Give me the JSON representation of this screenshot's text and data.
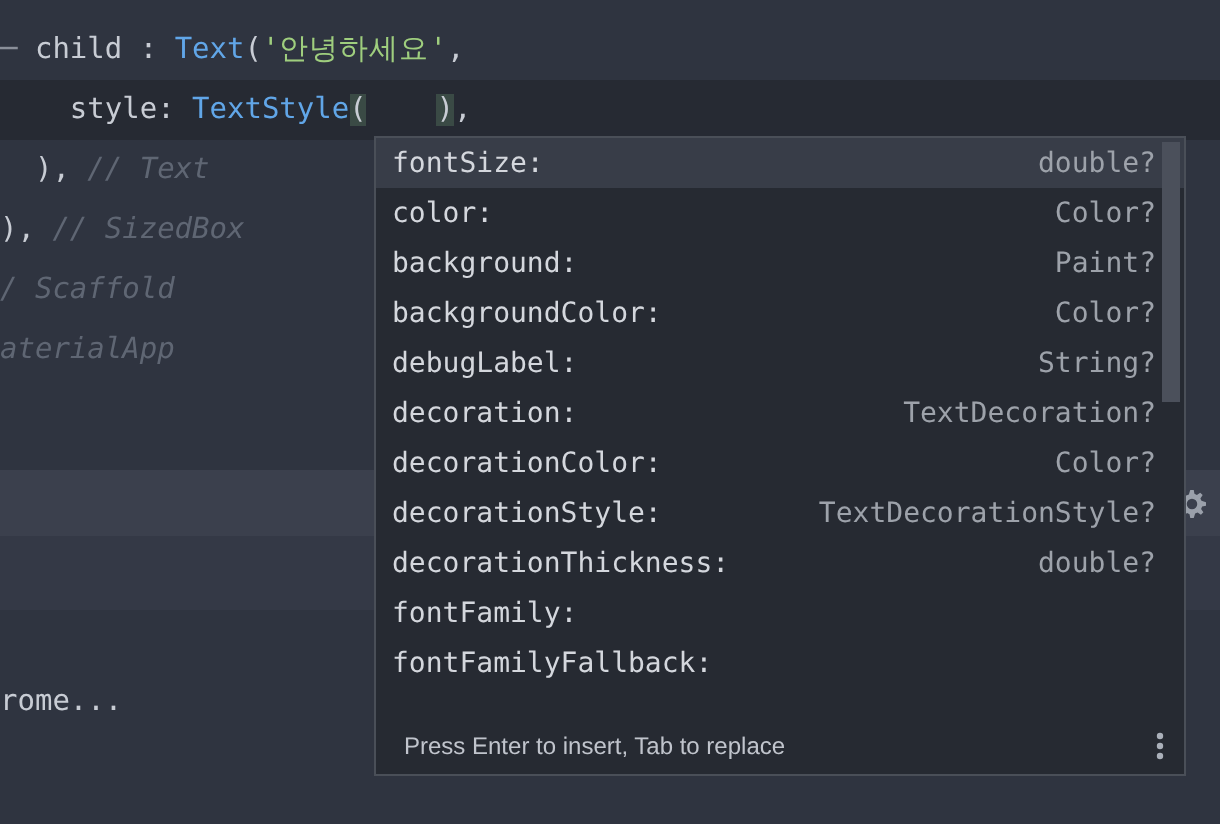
{
  "editor": {
    "lines": [
      {
        "current": false,
        "segments": [
          {
            "text": "─",
            "kind": "guide"
          },
          {
            "text": " child : ",
            "kind": "plain"
          },
          {
            "text": "Text",
            "kind": "type"
          },
          {
            "text": "(",
            "kind": "plain"
          },
          {
            "text": "'안녕하세요'",
            "kind": "string"
          },
          {
            "text": ",",
            "kind": "plain"
          }
        ]
      },
      {
        "current": true,
        "segments": [
          {
            "text": "    style: ",
            "kind": "plain"
          },
          {
            "text": "TextStyle",
            "kind": "type"
          },
          {
            "text": "(",
            "kind": "bracket"
          },
          {
            "text": ")",
            "kind": "bracket"
          },
          {
            "text": ",",
            "kind": "plain"
          }
        ]
      },
      {
        "current": false,
        "segments": [
          {
            "text": "  ), ",
            "kind": "plain"
          },
          {
            "text": "// Text",
            "kind": "comment"
          }
        ]
      },
      {
        "current": false,
        "segments": [
          {
            "text": "), ",
            "kind": "plain"
          },
          {
            "text": "// SizedBox",
            "kind": "comment"
          }
        ]
      },
      {
        "current": false,
        "segments": [
          {
            "text": "/ Scaffold",
            "kind": "comment"
          }
        ]
      },
      {
        "current": false,
        "segments": [
          {
            "text": "aterialApp",
            "kind": "comment"
          }
        ]
      }
    ]
  },
  "output": {
    "text": "rome..."
  },
  "autocomplete": {
    "items": [
      {
        "label": "fontSize:",
        "type": "double?",
        "selected": true
      },
      {
        "label": "color:",
        "type": "Color?",
        "selected": false
      },
      {
        "label": "background:",
        "type": "Paint?",
        "selected": false
      },
      {
        "label": "backgroundColor:",
        "type": "Color?",
        "selected": false
      },
      {
        "label": "debugLabel:",
        "type": "String?",
        "selected": false
      },
      {
        "label": "decoration:",
        "type": "TextDecoration?",
        "selected": false
      },
      {
        "label": "decorationColor:",
        "type": "Color?",
        "selected": false
      },
      {
        "label": "decorationStyle:",
        "type": "TextDecorationStyle?",
        "selected": false
      },
      {
        "label": "decorationThickness:",
        "type": "double?",
        "selected": false
      },
      {
        "label": "fontFamily:",
        "selected": false
      },
      {
        "label": "fontFamilyFallback:",
        "selected": false
      }
    ],
    "hint": "Press Enter to insert, Tab to replace"
  }
}
